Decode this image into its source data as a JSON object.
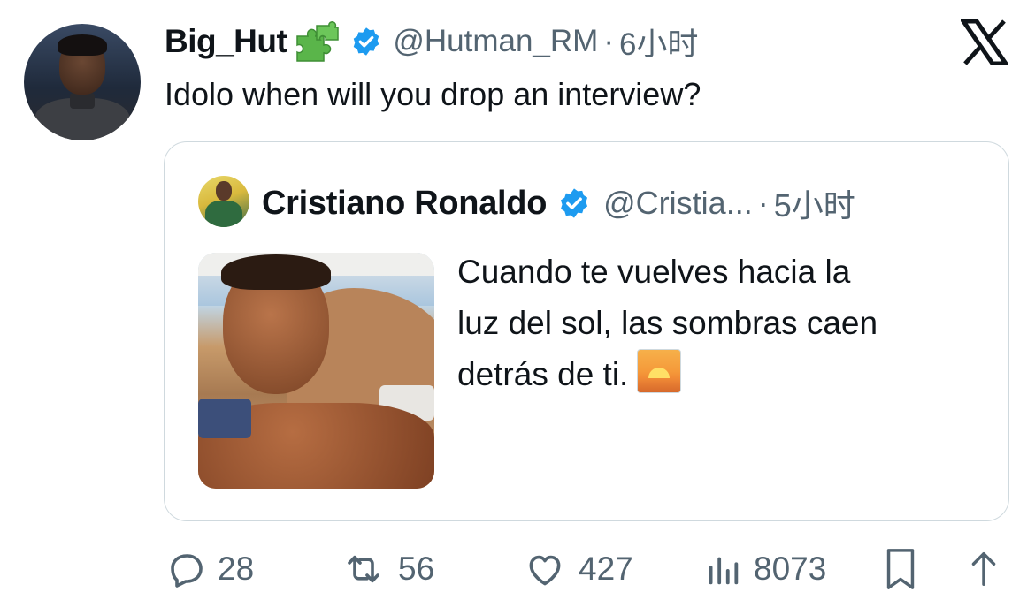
{
  "tweet": {
    "display_name": "Big_Hut",
    "name_emoji": "puzzle-piece",
    "handle": "@Hutman_RM",
    "separator": "·",
    "time": "6小时",
    "text": "Idolo when will you drop an interview?"
  },
  "quoted": {
    "display_name": "Cristiano Ronaldo",
    "handle": "@Cristia...",
    "separator": "·",
    "time": "5小时",
    "text_lines": [
      "Cuando te vuelves hacia la",
      "luz del sol, las sombras caen",
      "detrás de ti."
    ],
    "emoji": "sunset"
  },
  "actions": {
    "replies": "28",
    "retweets": "56",
    "likes": "427",
    "views": "8073"
  },
  "colors": {
    "verified": "#1d9bf0",
    "secondary_text": "#536471",
    "border": "#cfd9de"
  }
}
